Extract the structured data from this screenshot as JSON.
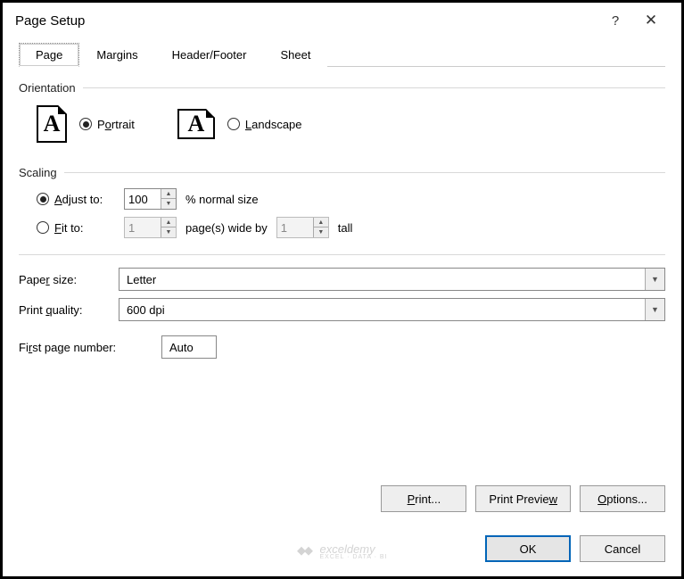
{
  "titlebar": {
    "title": "Page Setup",
    "help": "?",
    "close": "✕"
  },
  "tabs": [
    "Page",
    "Margins",
    "Header/Footer",
    "Sheet"
  ],
  "orientation": {
    "label": "Orientation",
    "portrait_pre": "P",
    "portrait_u": "o",
    "portrait_post": "rtrait",
    "landscape_pre": "",
    "landscape_u": "L",
    "landscape_post": "andscape",
    "glyph": "A"
  },
  "scaling": {
    "label": "Scaling",
    "adjust_pre": "",
    "adjust_u": "A",
    "adjust_post": "djust to:",
    "adjust_value": "100",
    "adjust_suffix": "% normal size",
    "fit_pre": "",
    "fit_u": "F",
    "fit_post": "it to:",
    "fit_wide": "1",
    "fit_mid": "page(s) wide by",
    "fit_tall": "1",
    "fit_suffix": "tall"
  },
  "paper": {
    "size_label_pre": "Pape",
    "size_label_u": "r",
    "size_label_post": " size:",
    "size_value": "Letter",
    "quality_label_pre": "Print ",
    "quality_label_u": "q",
    "quality_label_post": "uality:",
    "quality_value": "600 dpi"
  },
  "firstpage": {
    "label_pre": "Fi",
    "label_u": "r",
    "label_post": "st page number:",
    "value": "Auto"
  },
  "buttons": {
    "print_pre": "",
    "print_u": "P",
    "print_post": "rint...",
    "preview_pre": "Print Previe",
    "preview_u": "w",
    "preview_post": "",
    "options_pre": "",
    "options_u": "O",
    "options_post": "ptions...",
    "ok": "OK",
    "cancel": "Cancel"
  },
  "watermark": {
    "main": "exceldemy",
    "sub": "EXCEL · DATA · BI"
  }
}
